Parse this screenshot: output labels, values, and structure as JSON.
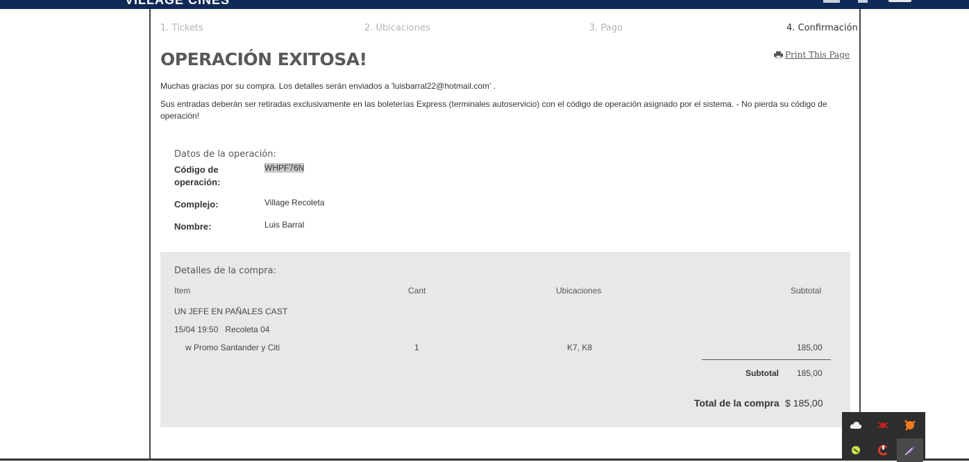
{
  "header": {
    "logo_text": "VILLAGE CINES"
  },
  "steps": [
    {
      "label": "1. Tickets",
      "active": false
    },
    {
      "label": "2. Ubicaciones",
      "active": false
    },
    {
      "label": "3. Pago",
      "active": false
    },
    {
      "label": "4. Confirmación",
      "active": true
    }
  ],
  "title": "OPERACIÓN EXITOSA!",
  "print_link": "Print This Page",
  "messages": {
    "thanks": "Muchas gracias por su compra. Los detalles serán enviados a 'luisbarral22@hotmail.com' .",
    "pickup": "Sus entradas deberán ser retiradas exclusivamente en las boleterías Express (terminales autoservicio) con el código de operación asignado por el sistema. - No pierda su código de operación!"
  },
  "operation": {
    "section_label": "Datos de la operación:",
    "code_label": "Código de operación:",
    "code_value": "WHPF76N",
    "complex_label": "Complejo:",
    "complex_value": "Village Recoleta",
    "name_label": "Nombre:",
    "name_value": "Luis Barral"
  },
  "purchase": {
    "section_label": "Detalles de la compra:",
    "columns": {
      "item": "Item",
      "qty": "Cant",
      "seats": "Ubicaciones",
      "subtotal": "Subtotal"
    },
    "movie": "UN JEFE EN PAÑALES CAST",
    "datetime": "15/04 19:50",
    "room": "Recoleta 04",
    "line": {
      "item": "w Promo Santander y Citi",
      "qty": "1",
      "seats": "K7, K8",
      "subtotal": "185,00"
    },
    "subtotal_label": "Subtotal",
    "subtotal_value": "185,00",
    "total_label": "Total de la compra",
    "total_value": "$ 185,00"
  },
  "tray_icons": [
    "cloud-icon",
    "bug-icon",
    "avast-icon",
    "green-app-icon",
    "ccleaner-icon",
    "feather-icon"
  ],
  "colors": {
    "header_bg": "#0f2a57",
    "purchase_bg": "#e8e8e8",
    "active_step": "#333333",
    "inactive_step": "#b3b3b3"
  }
}
